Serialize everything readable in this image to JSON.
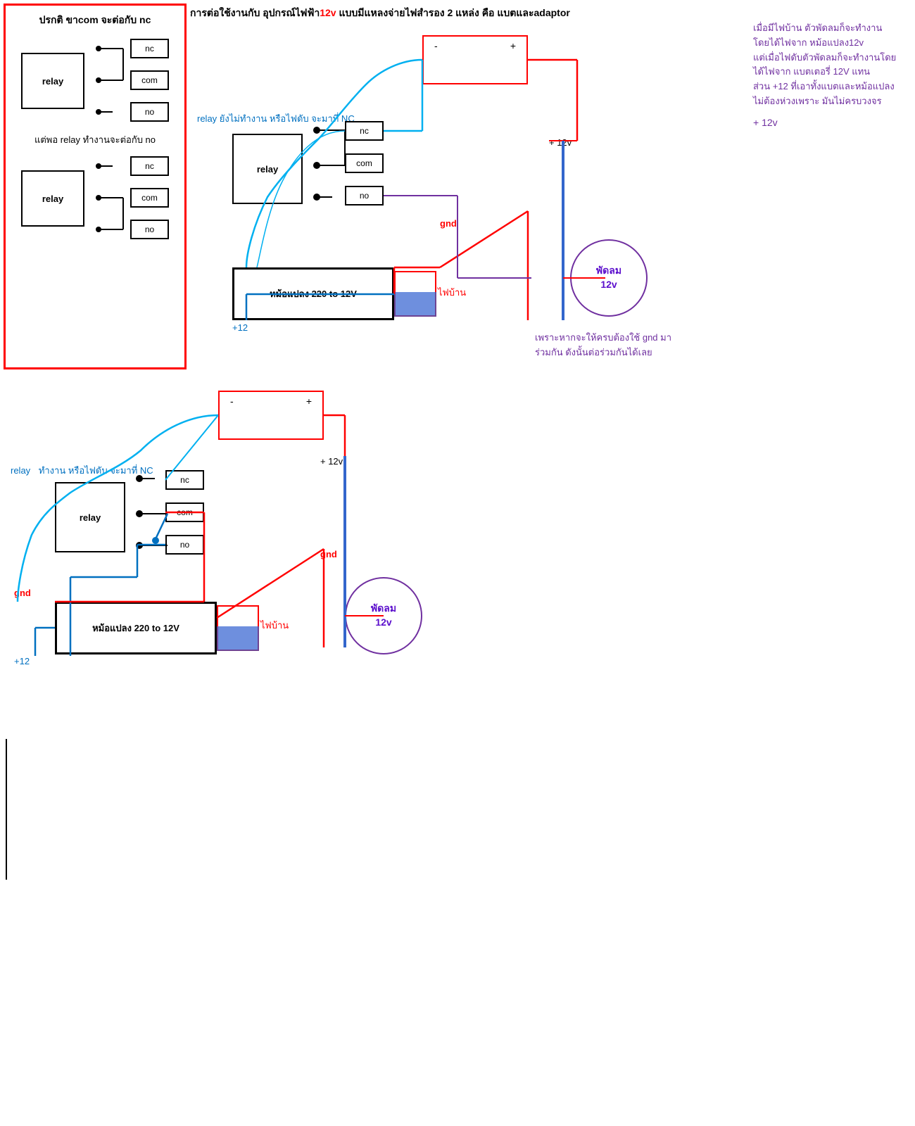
{
  "title": {
    "full": "การต่อใช้งานกับ  อุปกรณ์ไฟฟ้า",
    "voltage": "12v",
    "rest": " แบบมีแหลงจ่ายไฟสำรอง  2 แหล่ง  คือ  แบตและadaptor"
  },
  "legend": {
    "title": "ปรกติ  ขาcom จะต่อกับ  nc",
    "sub_title": "แต่พอ  relay ทำงานจะต่อกับ  no",
    "relay_label": "relay",
    "terminals": [
      "nc",
      "com",
      "no"
    ]
  },
  "top_diagram": {
    "relay_state_label": "relay ยังไม่ทำงาน   หรือไฟดับ  จะมาที่ NC",
    "relay_label": "relay",
    "terminals": [
      "nc",
      "com",
      "no"
    ],
    "power_supply_label": "หม้อแปลง   220 to 12V",
    "home_power_label": "ไฟบ้าน",
    "fan_label": "พัดลม\n12v",
    "gnd_label": "gnd",
    "plus12v_label": "+ 12v",
    "plus12_label": "+12"
  },
  "bottom_diagram": {
    "relay_state_label": "relay",
    "relay_working_label": "ทำงาน  หรือไฟดับ  จะมาที่ NC",
    "relay_label": "relay",
    "terminals": [
      "nc",
      "com",
      "no"
    ],
    "power_supply_label": "หม้อแปลง   220 to 12V",
    "home_power_label": "ไฟบ้าน",
    "fan_label": "พัดลม\n12v",
    "gnd_label": "gnd",
    "plus12v_label": "+ 12v",
    "plus12_label": "+12"
  },
  "info_text": {
    "line1": "เมื่อมีไฟบ้าน  ตัวพัดลมก็จะทำงาน",
    "line2": "โดยได้ไฟจาก  หม้อแปลง12v",
    "line3": "แต่เมื่อไฟดับตัวพัดลมก็จะทำงานโดย",
    "line4": "ได้ไฟจาก  แบตเตอรี่  12V แทน",
    "line5": "ส่วน  +12 ที่เอาทั้งแบตและหม้อแปลง",
    "line6": "ไม่ต้องห่วงเพราะ  มันไม่ครบวงจร",
    "plus12v": "+ 12v"
  },
  "bottom_note": {
    "line1": "เพราะหากจะให้ครบต้องใช้  gnd มา",
    "line2": "ร่วมกัน  ดังนั้นต่อร่วมกันได้เลย"
  }
}
